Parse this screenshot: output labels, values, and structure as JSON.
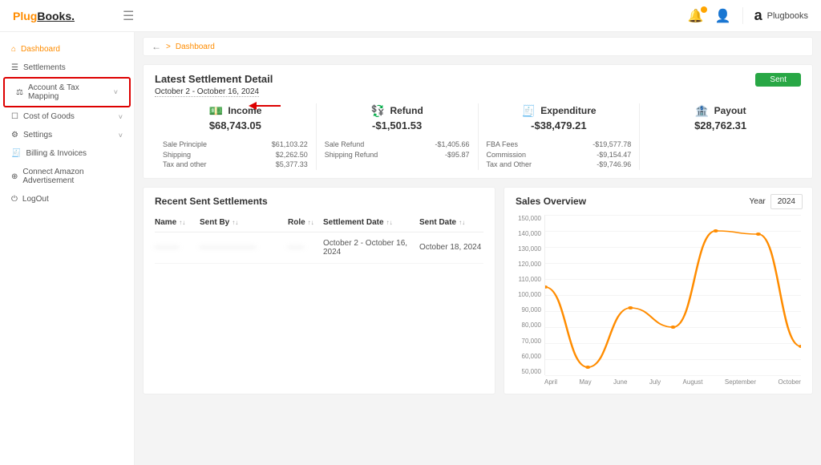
{
  "brand": {
    "plug": "Plug",
    "books": "Books."
  },
  "topbar": {
    "company": "Plugbooks"
  },
  "sidebar": {
    "items": [
      {
        "icon": "⌂",
        "label": "Dashboard",
        "active": true
      },
      {
        "icon": "☰",
        "label": "Settlements"
      },
      {
        "icon": "⚖",
        "label": "Account & Tax Mapping",
        "chev": true,
        "highlight": true
      },
      {
        "icon": "☐",
        "label": "Cost of Goods",
        "chev": true
      },
      {
        "icon": "⚙",
        "label": "Settings",
        "chev": true
      },
      {
        "icon": "🧾",
        "label": "Billing & Invoices"
      },
      {
        "icon": "⊕",
        "label": "Connect Amazon Advertisement"
      },
      {
        "icon": "⏻",
        "label": "LogOut"
      }
    ]
  },
  "crumb": {
    "link": "Dashboard"
  },
  "settlement": {
    "title": "Latest Settlement Detail",
    "date": "October 2 - October 16, 2024",
    "sent": "Sent",
    "metrics": [
      {
        "label": "Income",
        "value": "$68,743.05",
        "color": "#1a9c1a",
        "rows": [
          {
            "k": "Sale Principle",
            "v": "$61,103.22"
          },
          {
            "k": "Shipping",
            "v": "$2,262.50"
          },
          {
            "k": "Tax and other",
            "v": "$5,377.33"
          }
        ]
      },
      {
        "label": "Refund",
        "value": "-$1,501.53",
        "color": "#1a9c1a",
        "rows": [
          {
            "k": "Sale Refund",
            "v": "-$1,405.66"
          },
          {
            "k": "Shipping Refund",
            "v": "-$95.87"
          }
        ]
      },
      {
        "label": "Expenditure",
        "value": "-$38,479.21",
        "color": "#d33",
        "rows": [
          {
            "k": "FBA Fees",
            "v": "-$19,577.78"
          },
          {
            "k": "Commission",
            "v": "-$9,154.47"
          },
          {
            "k": "Tax and Other",
            "v": "-$9,746.96"
          }
        ]
      },
      {
        "label": "Payout",
        "value": "$28,762.31",
        "color": "#1a9c1a",
        "rows": []
      }
    ]
  },
  "recent": {
    "title": "Recent Sent Settlements",
    "headers": {
      "name": "Name",
      "sentby": "Sent By",
      "role": "Role",
      "sd": "Settlement Date",
      "sdate": "Sent Date"
    },
    "row": {
      "name": "———",
      "sentby": "———————",
      "role": "——",
      "sd": "October 2 - October 16, 2024",
      "sdate": "October 18, 2024"
    }
  },
  "sales": {
    "title": "Sales Overview",
    "year_label": "Year",
    "year_value": "2024"
  },
  "chart_data": {
    "type": "line",
    "title": "Sales Overview",
    "xlabel": "",
    "ylabel": "",
    "ylim": [
      50000,
      150000
    ],
    "y_ticks": [
      "150,000",
      "140,000",
      "130,000",
      "120,000",
      "110,000",
      "100,000",
      "90,000",
      "80,000",
      "70,000",
      "60,000",
      "50,000"
    ],
    "categories": [
      "April",
      "May",
      "June",
      "July",
      "August",
      "September",
      "October"
    ],
    "values": [
      105000,
      55000,
      92000,
      80000,
      140000,
      138000,
      68000
    ]
  }
}
